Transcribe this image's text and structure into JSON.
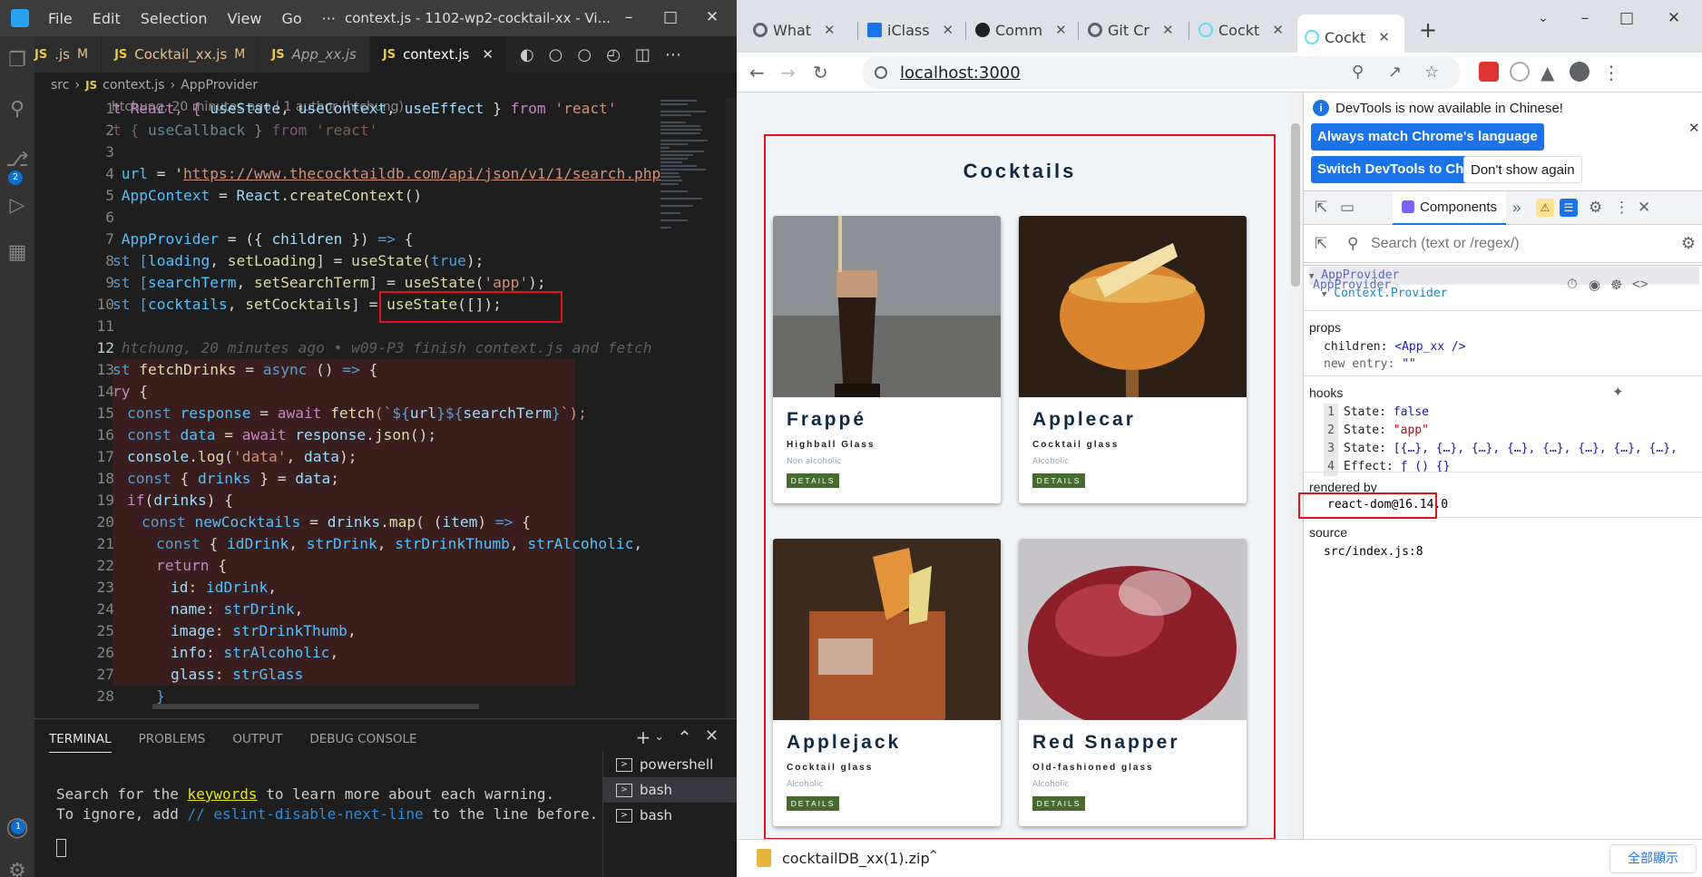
{
  "vscode": {
    "menu": [
      "File",
      "Edit",
      "Selection",
      "View",
      "Go",
      "···"
    ],
    "window_title": "context.js - 1102-wp2-cocktail-xx - Vi...",
    "tabs": [
      {
        "label": ".js",
        "mark": "M"
      },
      {
        "label": "Cocktail_xx.js",
        "mark": "M"
      },
      {
        "label": "App_xx.js"
      },
      {
        "label": "context.js"
      }
    ],
    "breadcrumb": [
      "src",
      "context.js",
      "AppProvider"
    ],
    "blame": "htchung, 20 minutes ago | 1 author (htchung)",
    "scm_badge": "2",
    "account_badge": "1",
    "line_numbers": [
      "1",
      "2",
      "3",
      "4",
      "5",
      "6",
      "7",
      "8",
      "9",
      "10",
      "11",
      "12",
      "13",
      "14",
      "15",
      "16",
      "17",
      "18",
      "19",
      "20",
      "21",
      "22",
      "23",
      "24",
      "25",
      "26",
      "27",
      "28"
    ],
    "code": {
      "l1a": "t React, { ",
      "l1b": "useState",
      "l1c": ", ",
      "l1d": "useContext",
      "l1e": ", ",
      "l1f": "useEffect",
      "l1g": " } ",
      "l1h": "from",
      "l1i": " 'react'",
      "l2a": "t { ",
      "l2b": "useCallback",
      "l2c": " } ",
      "l2d": "from",
      "l2e": " 'react'",
      "l4a": " ",
      "l4b": "url",
      "l4c": " = '",
      "l4d": "https://www.thecocktaildb.com/api/json/v1/1/search.php",
      "l5a": " ",
      "l5b": "AppContext",
      "l5c": " = ",
      "l5d": "React",
      "l5e": ".",
      "l5f": "createContext",
      "l5g": "()",
      "l7a": " ",
      "l7b": "AppProvider",
      "l7c": " = ({ ",
      "l7d": "children",
      "l7e": " }) ",
      "l7f": "=>",
      "l7g": " {",
      "l8a": "st [",
      "l8b": "loading",
      "l8c": ", ",
      "l8d": "setLoading",
      "l8e": "] = ",
      "l8f": "useState",
      "l8g": "(",
      "l8h": "true",
      "l8i": ");",
      "l9a": "st [",
      "l9b": "searchTerm",
      "l9c": ", ",
      "l9d": "setSearchTerm",
      "l9e": "] = ",
      "l9f": "useState",
      "l9g": "(",
      "l9h": "'app'",
      "l9i": ");",
      "l10a": "st [",
      "l10b": "cocktails",
      "l10c": ", ",
      "l10d": "setCocktails",
      "l10e": "] = ",
      "l10f": "useState",
      "l10g": "([]);",
      "l12": " htchung, 20 minutes ago • w09-P3 finish context.js and fetch",
      "l13a": "st ",
      "l13b": "fetchDrinks",
      "l13c": " = ",
      "l13d": "async",
      "l13e": " () ",
      "l13f": "=>",
      "l13g": " {",
      "l14a": "ry",
      "l14b": " {",
      "l15a": "const ",
      "l15b": "response",
      "l15c": " = ",
      "l15d": "await",
      "l15e": " ",
      "l15f": "fetch",
      "l15g": "(`",
      "l15h": "${",
      "l15i": "url",
      "l15j": "}${",
      "l15k": "searchTerm",
      "l15l": "}",
      "l15m": "`);",
      "l16a": "const ",
      "l16b": "data",
      "l16c": " = ",
      "l16d": "await",
      "l16e": " ",
      "l16f": "response",
      "l16g": ".",
      "l16h": "json",
      "l16i": "();",
      "l17a": "console",
      "l17b": ".",
      "l17c": "log",
      "l17d": "(",
      "l17e": "'data'",
      "l17f": ", ",
      "l17g": "data",
      "l17h": ");",
      "l18a": "const ",
      "l18b": "{ ",
      "l18c": "drinks",
      "l18d": " } = ",
      "l18e": "data",
      ";l18f": "",
      "l18g": ";",
      "l19a": "if",
      "l19b": "(",
      "l19c": "drinks",
      "l19d": ") {",
      "l20a": "const ",
      "l20b": "newCocktails",
      "l20c": " = ",
      "l20d": "drinks",
      "l20e": ".",
      "l20f": "map",
      "l20g": "( (",
      "l20h": "item",
      "l20i": ") ",
      "l20j": "=>",
      "l20k": " {",
      "l21a": "const ",
      "l21b": "{ ",
      "l21c": "idDrink",
      "l21d": ", ",
      "l21e": "strDrink",
      "l21f": ", ",
      "l21g": "strDrinkThumb",
      "l21h": ", ",
      "l21i": "strAlcoholic",
      ",l21j": "",
      "l21k": ",",
      "l22a": "return",
      "l22b": " {",
      "l23a": "id",
      "l23b": ": ",
      "l23c": "idDrink",
      "l23d": ",",
      "l24a": "name",
      "l24b": ": ",
      "l24c": "strDrink",
      "l24d": ",",
      "l25a": "image",
      "l25b": ": ",
      "l25c": "strDrinkThumb",
      "l25d": ",",
      "l26a": "info",
      "l26b": ": ",
      "l26c": "strAlcoholic",
      "l26d": ",",
      "l27a": "glass",
      "l27b": ": ",
      "l27c": "strGlass",
      "l28a": "}"
    },
    "panel_tabs": [
      "TERMINAL",
      "PROBLEMS",
      "OUTPUT",
      "DEBUG CONSOLE"
    ],
    "terminal": {
      "line1_a": "Search for the ",
      "line1_kw": "keywords",
      "line1_b": " to learn more about each warning.",
      "line2_a": "To ignore, add ",
      "line2_c": "// eslint-disable-next-line",
      "line2_b": " to the line before."
    },
    "shells": [
      "powershell",
      "bash",
      "bash"
    ]
  },
  "chrome": {
    "tabs": [
      {
        "label": "What",
        "color": "#5f6368"
      },
      {
        "label": "iClass",
        "color": "#1a73e8"
      },
      {
        "label": "Comm",
        "color": "#202124"
      },
      {
        "label": "Git Cr",
        "color": "#5f6368"
      },
      {
        "label": "Cockt",
        "color": "#61dafb"
      },
      {
        "label": "Cockt",
        "color": "#61dafb"
      }
    ],
    "url": "localhost:3000",
    "page": {
      "title": "Cocktails",
      "details_label": "DETAILS",
      "cards": [
        {
          "name": "Frappé",
          "glass": "Highball Glass",
          "info": "Non alcoholic"
        },
        {
          "name": "Applecar",
          "glass": "Cocktail glass",
          "info": "Alcoholic"
        },
        {
          "name": "Applejack",
          "glass": "Cocktail glass",
          "info": "Alcoholic"
        },
        {
          "name": "Red Snapper",
          "glass": "Old-fashioned glass",
          "info": "Alcoholic"
        }
      ]
    },
    "devtools": {
      "banner": "DevTools is now available in Chinese!",
      "btn_match": "Always match Chrome's language",
      "btn_switch": "Switch DevTools to Chinese",
      "btn_dont": "Don't show again",
      "tab_components": "Components",
      "search_placeholder": "Search (text or /regex/)",
      "tree": [
        "AppProvider",
        "Context.Provider"
      ],
      "selected": "AppProvider",
      "props_title": "props",
      "props": [
        {
          "k": "children:",
          "v": "<App_xx />"
        },
        {
          "k": "new entry:",
          "v": "\"\""
        }
      ],
      "hooks_title": "hooks",
      "hooks": [
        {
          "n": "1",
          "k": "State:",
          "v": "false"
        },
        {
          "n": "2",
          "k": "State:",
          "v": "\"app\""
        },
        {
          "n": "3",
          "k": "State:",
          "v": "[{…}, {…}, {…}, {…}, {…}, {…}, {…}, {…},"
        },
        {
          "n": "4",
          "k": "Effect:",
          "v": "ƒ () {}"
        }
      ],
      "rendered_title": "rendered by",
      "rendered": "react-dom@16.14.0",
      "source_title": "source",
      "source": "src/index.js:8"
    },
    "download": {
      "file": "cocktailDB_xx(1).zip",
      "show_all": "全部顯示"
    }
  },
  "colors": {
    "highlight": "#e2131b",
    "details_btn": "#476a2e",
    "accent": "#1a73e8"
  }
}
